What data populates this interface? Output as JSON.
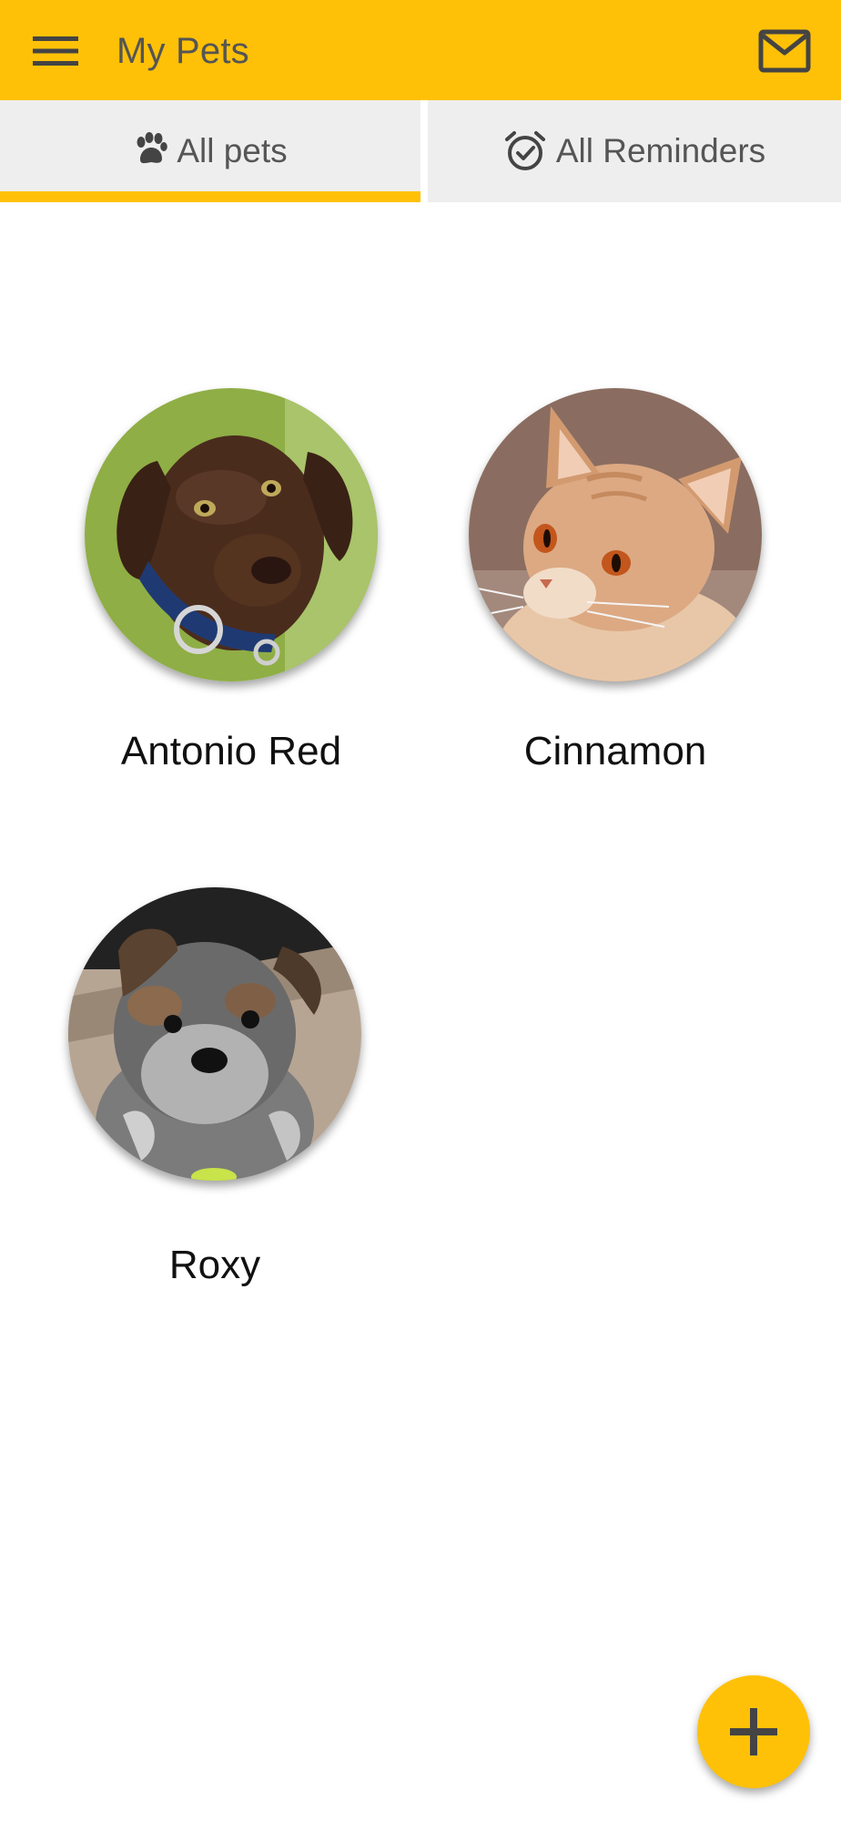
{
  "app_bar": {
    "title": "My Pets",
    "menu_icon": "menu-icon",
    "mail_icon": "mail-icon",
    "color": "#FFC107"
  },
  "tabs": [
    {
      "label": "All pets",
      "icon": "paw-icon",
      "selected": true
    },
    {
      "label": "All Reminders",
      "icon": "alarm-check-icon",
      "selected": false
    }
  ],
  "pets": [
    {
      "name": "Antonio Red",
      "photo": "chocolate labrador puppy"
    },
    {
      "name": "Cinnamon",
      "photo": "orange tabby cat"
    },
    {
      "name": "Roxy",
      "photo": "grey schnauzer puppy"
    }
  ],
  "fab": {
    "icon": "plus-icon"
  }
}
